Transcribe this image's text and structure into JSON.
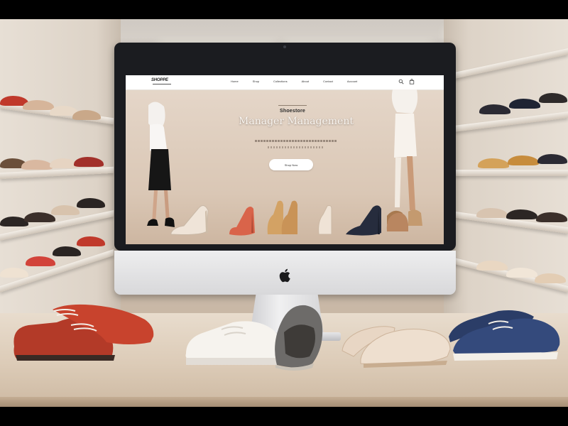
{
  "website": {
    "logo_text": "SHOPPE",
    "nav_links": [
      "Home",
      "Shop",
      "Collections",
      "About",
      "Contact",
      "Account"
    ],
    "hero_kicker": "Shoestore",
    "hero_title": "Manager Management",
    "hero_button_label": "Shop Now"
  },
  "scene": {
    "device": "desktop monitor",
    "brand_icon": "apple-icon"
  },
  "colors": {
    "screen_background": "#dac7b5",
    "nav_background": "#ffffff",
    "hero_title": "#fbf7f2",
    "cta_background": "#ffffff"
  },
  "icons": [
    "search-icon",
    "bag-icon",
    "user-icon",
    "apple-icon"
  ]
}
